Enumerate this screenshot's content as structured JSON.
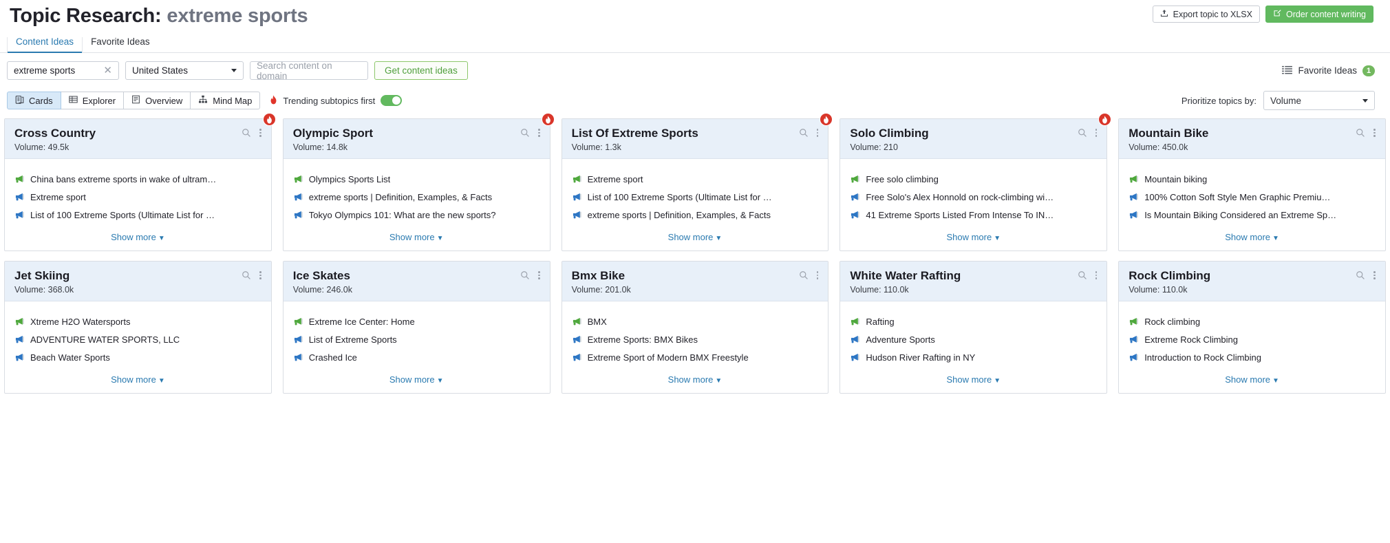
{
  "header": {
    "title_prefix": "Topic Research:",
    "title_keyword": "extreme sports",
    "export_button": "Export topic to XLSX",
    "order_button": "Order content writing",
    "export_icon": "upload-icon",
    "order_icon": "pencil-square-icon"
  },
  "tabs": [
    {
      "label": "Content Ideas",
      "active": true
    },
    {
      "label": "Favorite Ideas",
      "active": false
    }
  ],
  "filters": {
    "keyword_value": "extreme sports",
    "clear_icon": "close-icon",
    "country_value": "United States",
    "domain_placeholder": "Search content on domain",
    "domain_value": "",
    "get_ideas_button": "Get content ideas",
    "favorite_ideas_label": "Favorite Ideas",
    "favorite_ideas_count": "1",
    "favorite_ideas_icon": "list-icon"
  },
  "views": {
    "modes": [
      {
        "label": "Cards",
        "icon": "cards-icon",
        "active": true
      },
      {
        "label": "Explorer",
        "icon": "table-icon",
        "active": false
      },
      {
        "label": "Overview",
        "icon": "document-icon",
        "active": false
      },
      {
        "label": "Mind Map",
        "icon": "mindmap-icon",
        "active": false
      }
    ],
    "trending_label": "Trending subtopics first",
    "trending_icon": "flame-icon",
    "trending_on": true,
    "prioritize_label": "Prioritize topics by:",
    "prioritize_value": "Volume"
  },
  "cards": [
    {
      "title": "Cross Country",
      "volume_label": "Volume:",
      "volume_value": "49.5k",
      "trending": true,
      "ideas": [
        {
          "icon": "megaphone-green-icon",
          "text": "China bans extreme sports in wake of ultram…"
        },
        {
          "icon": "megaphone-blue-icon",
          "text": "Extreme sport"
        },
        {
          "icon": "megaphone-blue-icon",
          "text": "List of 100 Extreme Sports (Ultimate List for …"
        }
      ],
      "show_more": "Show more"
    },
    {
      "title": "Olympic Sport",
      "volume_label": "Volume:",
      "volume_value": "14.8k",
      "trending": true,
      "ideas": [
        {
          "icon": "megaphone-green-icon",
          "text": "Olympics Sports List"
        },
        {
          "icon": "megaphone-blue-icon",
          "text": "extreme sports | Definition, Examples, & Facts"
        },
        {
          "icon": "megaphone-blue-icon",
          "text": "Tokyo Olympics 101: What are the new sports?"
        }
      ],
      "show_more": "Show more"
    },
    {
      "title": "List Of Extreme Sports",
      "volume_label": "Volume:",
      "volume_value": "1.3k",
      "trending": true,
      "ideas": [
        {
          "icon": "megaphone-green-icon",
          "text": "Extreme sport"
        },
        {
          "icon": "megaphone-blue-icon",
          "text": "List of 100 Extreme Sports (Ultimate List for …"
        },
        {
          "icon": "megaphone-blue-icon",
          "text": "extreme sports | Definition, Examples, & Facts"
        }
      ],
      "show_more": "Show more"
    },
    {
      "title": "Solo Climbing",
      "volume_label": "Volume:",
      "volume_value": "210",
      "trending": true,
      "ideas": [
        {
          "icon": "megaphone-green-icon",
          "text": "Free solo climbing"
        },
        {
          "icon": "megaphone-blue-icon",
          "text": "Free Solo's Alex Honnold on rock-climbing wi…"
        },
        {
          "icon": "megaphone-blue-icon",
          "text": "41 Extreme Sports Listed From Intense To IN…"
        }
      ],
      "show_more": "Show more"
    },
    {
      "title": "Mountain Bike",
      "volume_label": "Volume:",
      "volume_value": "450.0k",
      "trending": false,
      "ideas": [
        {
          "icon": "megaphone-green-icon",
          "text": "Mountain biking"
        },
        {
          "icon": "megaphone-blue-icon",
          "text": "100% Cotton Soft Style Men Graphic Premiu…"
        },
        {
          "icon": "megaphone-blue-icon",
          "text": "Is Mountain Biking Considered an Extreme Sp…"
        }
      ],
      "show_more": "Show more"
    },
    {
      "title": "Jet Skiing",
      "volume_label": "Volume:",
      "volume_value": "368.0k",
      "trending": false,
      "ideas": [
        {
          "icon": "megaphone-green-icon",
          "text": "Xtreme H2O Watersports"
        },
        {
          "icon": "megaphone-blue-icon",
          "text": "ADVENTURE WATER SPORTS, LLC"
        },
        {
          "icon": "megaphone-blue-icon",
          "text": "Beach Water Sports"
        }
      ],
      "show_more": "Show more"
    },
    {
      "title": "Ice Skates",
      "volume_label": "Volume:",
      "volume_value": "246.0k",
      "trending": false,
      "ideas": [
        {
          "icon": "megaphone-green-icon",
          "text": "Extreme Ice Center: Home"
        },
        {
          "icon": "megaphone-blue-icon",
          "text": "List of Extreme Sports"
        },
        {
          "icon": "megaphone-blue-icon",
          "text": "Crashed Ice"
        }
      ],
      "show_more": "Show more"
    },
    {
      "title": "Bmx Bike",
      "volume_label": "Volume:",
      "volume_value": "201.0k",
      "trending": false,
      "ideas": [
        {
          "icon": "megaphone-green-icon",
          "text": "BMX"
        },
        {
          "icon": "megaphone-blue-icon",
          "text": "Extreme Sports: BMX Bikes"
        },
        {
          "icon": "megaphone-blue-icon",
          "text": "Extreme Sport of Modern BMX Freestyle"
        }
      ],
      "show_more": "Show more"
    },
    {
      "title": "White Water Rafting",
      "volume_label": "Volume:",
      "volume_value": "110.0k",
      "trending": false,
      "ideas": [
        {
          "icon": "megaphone-green-icon",
          "text": "Rafting"
        },
        {
          "icon": "megaphone-blue-icon",
          "text": "Adventure Sports"
        },
        {
          "icon": "megaphone-blue-icon",
          "text": "Hudson River Rafting in NY"
        }
      ],
      "show_more": "Show more"
    },
    {
      "title": "Rock Climbing",
      "volume_label": "Volume:",
      "volume_value": "110.0k",
      "trending": false,
      "ideas": [
        {
          "icon": "megaphone-green-icon",
          "text": "Rock climbing"
        },
        {
          "icon": "megaphone-blue-icon",
          "text": "Extreme Rock Climbing"
        },
        {
          "icon": "megaphone-blue-icon",
          "text": "Introduction to Rock Climbing"
        }
      ],
      "show_more": "Show more"
    }
  ],
  "colors": {
    "accent_blue": "#2a7ab0",
    "brand_green": "#61b95f",
    "trending_red": "#d9362a",
    "card_head_bg": "#e8f0f9"
  }
}
